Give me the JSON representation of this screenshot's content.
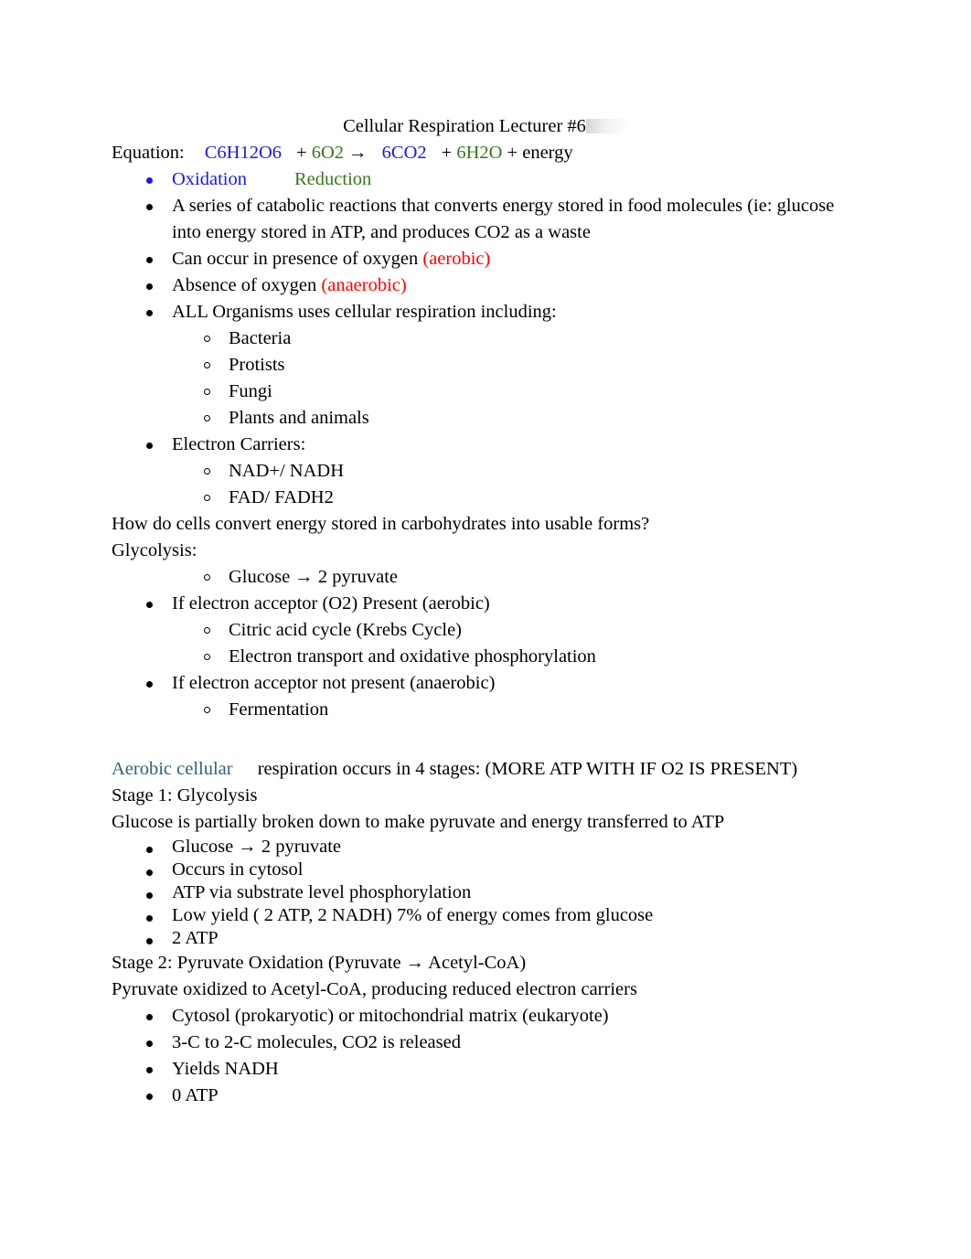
{
  "document": {
    "title": "Cellular Respiration Lecturer #6",
    "equation": {
      "label": "Equation:",
      "glucose": "C6H12O6",
      "plus1": "+",
      "oxygen": "6O2",
      "arrow": "→",
      "co2": "6CO2",
      "plus2": "+",
      "water": "6H2O",
      "plus3": "+",
      "energy": "energy"
    },
    "redox": {
      "oxidation": "Oxidation",
      "reduction": "Reduction"
    },
    "intro_bullets": [
      "A series of catabolic reactions that converts energy stored in food molecules (ie: glucose into energy stored in ATP, and produces CO2 as a waste",
      "Can occur in presence of oxygen ",
      "Absence of oxygen ",
      "ALL Organisms  uses cellular respiration including:"
    ],
    "aerobic_tag": "(aerobic)",
    "anaerobic_tag": "(anaerobic)",
    "catabolic_line_1": "A series of catabolic reactions that converts energy stored in food molecules (ie: glucose",
    "catabolic_line_2": "into energy stored in ATP, and produces CO2 as a waste",
    "can_occur_text": "Can occur in presence of oxygen ",
    "absence_text": "Absence of oxygen ",
    "all_organisms": "ALL Organisms  uses cellular respiration including:",
    "organisms": [
      "Bacteria",
      "Protists",
      "Fungi",
      "Plants and animals"
    ],
    "electron_carriers_heading": "Electron Carriers:",
    "electron_carriers": [
      "NAD+/ NADH",
      "FAD/ FADH2"
    ],
    "question": "How do cells convert energy stored in carbohydrates into usable forms?",
    "glycolysis_label": "Glycolysis:",
    "glycolysis_sub": "Glucose → 2 pyruvate",
    "acceptor_present": "If electron acceptor (O2) Present (aerobic)",
    "acceptor_present_subs": [
      "Citric acid cycle (Krebs Cycle)",
      "Electron transport and oxidative phosphorylation"
    ],
    "acceptor_absent": "If electron acceptor not present (anaerobic)",
    "acceptor_absent_subs": [
      "Fermentation"
    ],
    "aerobic_heading": {
      "colored": "Aerobic cellular",
      "rest": " respiration occurs in 4 stages: (MORE ATP WITH IF O2 IS PRESENT)"
    },
    "stage1": {
      "heading": "Stage 1: Glycolysis",
      "description": "Glucose is partially broken down to make pyruvate and energy transferred to ATP",
      "bullets": [
        "Glucose → 2 pyruvate",
        "Occurs in cytosol",
        "ATP via substrate level phosphorylation",
        "Low yield ( 2 ATP, 2 NADH) 7% of energy comes from glucose",
        "2 ATP"
      ]
    },
    "stage2": {
      "heading": "Stage 2: Pyruvate Oxidation (Pyruvate → Acetyl-CoA)",
      "description": "Pyruvate oxidized to Acetyl-CoA, producing reduced electron carriers",
      "bullets": [
        "Cytosol (prokaryotic) or mitochondrial matrix (eukaryote)",
        "3-C to 2-C molecules, CO2 is released",
        "Yields NADH",
        "0 ATP"
      ]
    }
  },
  "colors": {
    "blue": "#1a1ae0",
    "green": "#38761d",
    "red": "#ff0000",
    "teal": "#2e6377",
    "text": "#000000",
    "background": "#ffffff"
  }
}
